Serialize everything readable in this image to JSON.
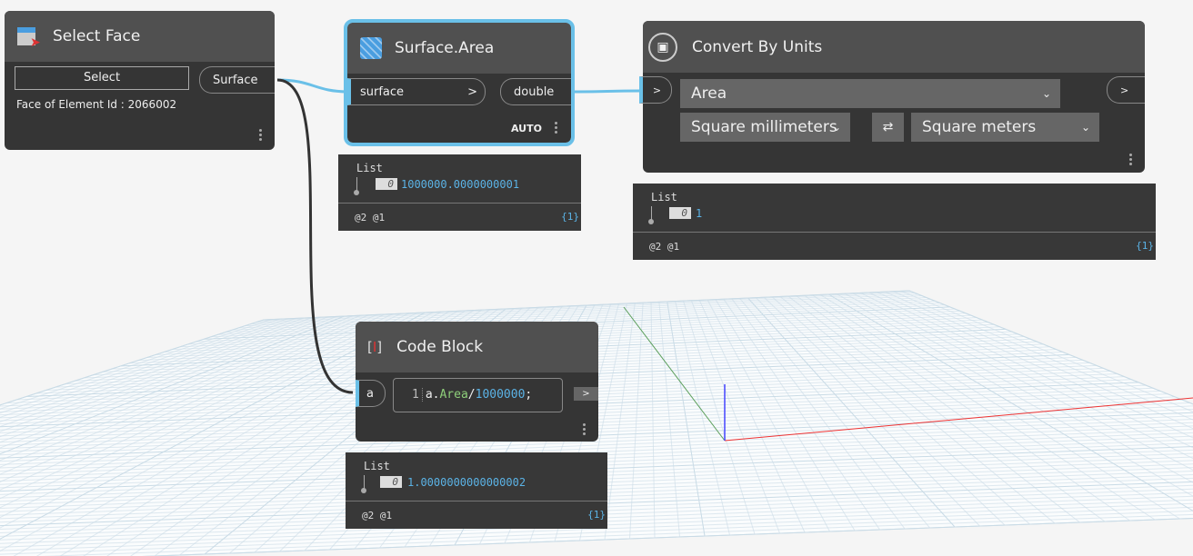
{
  "nodes": {
    "select_face": {
      "title": "Select Face",
      "icon": "select-face-icon",
      "select_button": "Select",
      "output_port": "Surface",
      "info": "Face of Element Id : 2066002"
    },
    "surface_area": {
      "title": "Surface.Area",
      "icon": "surface-area-icon",
      "input_port": "surface",
      "input_arrow": ">",
      "output_port": "double",
      "lacing": "AUTO",
      "preview": {
        "header": "List",
        "index": "0",
        "value": "1000000.0000000001",
        "levels": "@2 @1",
        "count": "{1}"
      }
    },
    "convert_by_units": {
      "title": "Convert By Units",
      "icon": "convert-units-icon",
      "input_arrow": ">",
      "output_arrow": ">",
      "quantity": "Area",
      "from_unit": "Square millimeters",
      "to_unit": "Square meters",
      "swap": "⇄",
      "preview": {
        "header": "List",
        "index": "0",
        "value": "1",
        "levels": "@2 @1",
        "count": "{1}"
      }
    },
    "code_block": {
      "title": "Code Block",
      "icon": "code-block-icon",
      "input_port": "a",
      "line_number": "1",
      "code_var": "a.",
      "code_prop": "Area",
      "code_op": "/",
      "code_num": "1000000",
      "code_end": ";",
      "output_arrow": ">",
      "preview": {
        "header": "List",
        "index": "0",
        "value": "1.0000000000000002",
        "levels": "@2 @1",
        "count": "{1}"
      }
    }
  },
  "colors": {
    "accent": "#6ac0e8",
    "node_body": "#353535",
    "node_header": "#505050",
    "value": "#5bb3e6"
  }
}
